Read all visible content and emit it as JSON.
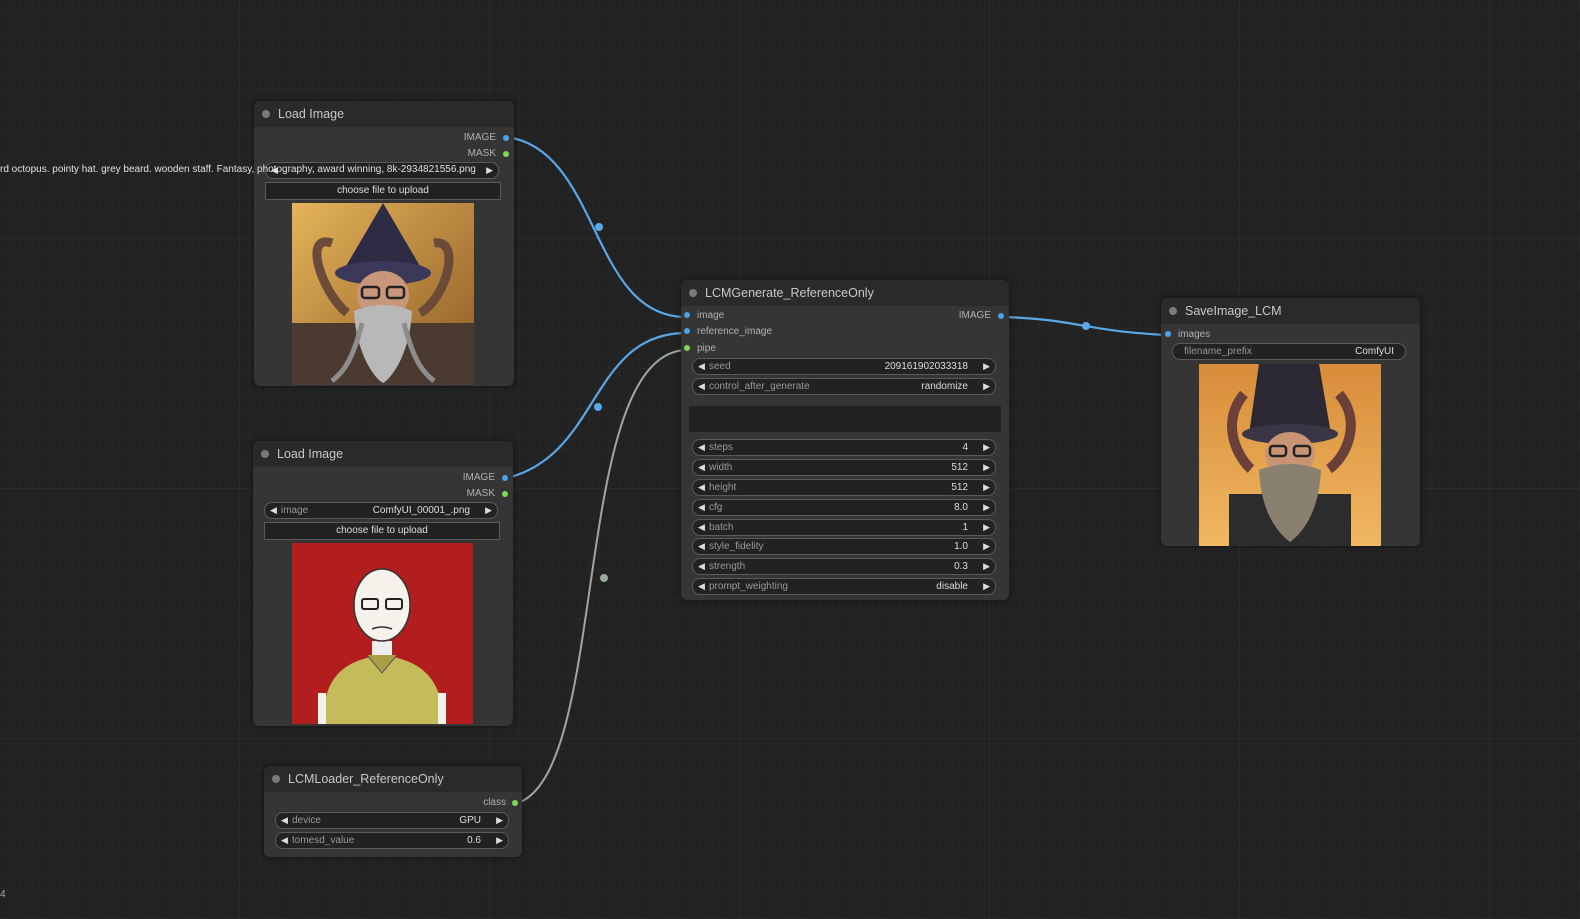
{
  "colors": {
    "image_slot": "#4aa3e8",
    "mask_slot": "#7ed957",
    "link_image": "#5aa7e8",
    "link_pipe": "#9aaa9a",
    "canvas": "#222222"
  },
  "overflow_text": "rd octopus. pointy hat. grey beard. wooden staff. Fantasy, photography, award winning, 8k-2934821556.png",
  "corner_text": "4",
  "load1": {
    "title": "Load Image",
    "out_image": "IMAGE",
    "out_mask": "MASK",
    "upload_label": "choose file to upload",
    "preview_icon": "wizard-octopus-photo"
  },
  "load2": {
    "title": "Load Image",
    "out_image": "IMAGE",
    "out_mask": "MASK",
    "widget_label": "image",
    "widget_value": "ComfyUI_00001_.png",
    "upload_label": "choose file to upload",
    "preview_icon": "man-cartoon-red-bg"
  },
  "loader": {
    "title": "LCMLoader_ReferenceOnly",
    "out_class": "class",
    "device_label": "device",
    "device_value": "GPU",
    "tomesd_label": "tomesd_value",
    "tomesd_value": "0.6"
  },
  "gen": {
    "title": "LCMGenerate_ReferenceOnly",
    "in_image": "image",
    "in_ref": "reference_image",
    "in_pipe": "pipe",
    "out_image": "IMAGE",
    "widgets": [
      {
        "label": "seed",
        "value": "209161902033318"
      },
      {
        "label": "control_after_generate",
        "value": "randomize"
      },
      {
        "label": "steps",
        "value": "4"
      },
      {
        "label": "width",
        "value": "512"
      },
      {
        "label": "height",
        "value": "512"
      },
      {
        "label": "cfg",
        "value": "8.0"
      },
      {
        "label": "batch",
        "value": "1"
      },
      {
        "label": "style_fidelity",
        "value": "1.0"
      },
      {
        "label": "strength",
        "value": "0.3"
      },
      {
        "label": "prompt_weighting",
        "value": "disable"
      }
    ]
  },
  "save": {
    "title": "SaveImage_LCM",
    "in_images": "images",
    "prefix_label": "filename_prefix",
    "prefix_value": "ComfyUI",
    "preview_icon": "wizard-generated-output"
  }
}
